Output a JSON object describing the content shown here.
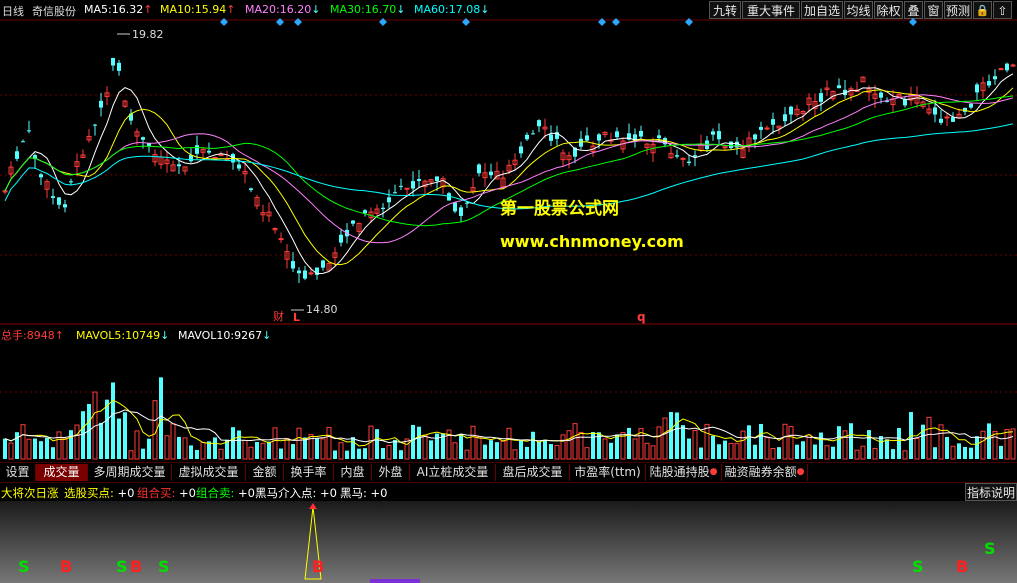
{
  "stock": {
    "period": "日线",
    "name": "奇信股份"
  },
  "ma": [
    {
      "label": "MA5:",
      "value": "16.32",
      "arrow": "↑",
      "color": "#ffffff"
    },
    {
      "label": "MA10:",
      "value": "15.94",
      "arrow": "↑",
      "color": "#ffff00"
    },
    {
      "label": "MA20:",
      "value": "16.20",
      "arrow": "↓",
      "color": "#ff80ff"
    },
    {
      "label": "MA30:",
      "value": "16.70",
      "arrow": "↓",
      "color": "#00ff00"
    },
    {
      "label": "MA60:",
      "value": "17.08",
      "arrow": "↓",
      "color": "#00ffff"
    }
  ],
  "toolbar": [
    "九转",
    "重大事件",
    "加自选",
    "均线",
    "除权",
    "叠",
    "窗",
    "预测"
  ],
  "price_chart": {
    "high_label": "19.82",
    "low_label": "14.80",
    "marker_cai": "财",
    "marker_l": "L",
    "marker_q": "q",
    "watermark_title": "第一股票公式网",
    "watermark_url": "www.chnmoney.com"
  },
  "volume_header": {
    "total_label": "总手:",
    "total_value": "8948",
    "total_arrow": "↑",
    "mavol5_label": "MAVOL5:",
    "mavol5_value": "10749",
    "mavol5_arrow": "↓",
    "mavol10_label": "MAVOL10:",
    "mavol10_value": "9267",
    "mavol10_arrow": "↓"
  },
  "tabs": [
    {
      "label": "设置",
      "active": false
    },
    {
      "label": "成交量",
      "active": true
    },
    {
      "label": "多周期成交量",
      "active": false
    },
    {
      "label": "虚拟成交量",
      "active": false
    },
    {
      "label": "金额",
      "active": false
    },
    {
      "label": "换手率",
      "active": false
    },
    {
      "label": "内盘",
      "active": false
    },
    {
      "label": "外盘",
      "active": false
    },
    {
      "label": "AI立桩成交量",
      "active": false
    },
    {
      "label": "盘后成交量",
      "active": false
    },
    {
      "label": "市盈率(ttm)",
      "active": false
    },
    {
      "label": "陆股通持股",
      "active": false
    },
    {
      "label": "融资融券余额",
      "active": false
    }
  ],
  "indicator": {
    "name": "大将次日涨",
    "items": [
      {
        "label": "选股买点:",
        "value": "+0",
        "color": "#ffff00"
      },
      {
        "label": "组合买:",
        "value": "+0",
        "color": "#ff3030"
      },
      {
        "label": "组合卖:",
        "value": "+0",
        "color": "#00ff00"
      },
      {
        "label": "黑马介入点:",
        "value": "+0",
        "color": "#ffffff"
      },
      {
        "label": "黑马:",
        "value": "+0",
        "color": "#ffffff"
      }
    ],
    "help_button": "指标说明"
  },
  "signals": {
    "sell": "S",
    "buy": "B"
  },
  "colors": {
    "up": "#ff3c3c",
    "down": "#54ffff",
    "grid": "#6b0000"
  }
}
